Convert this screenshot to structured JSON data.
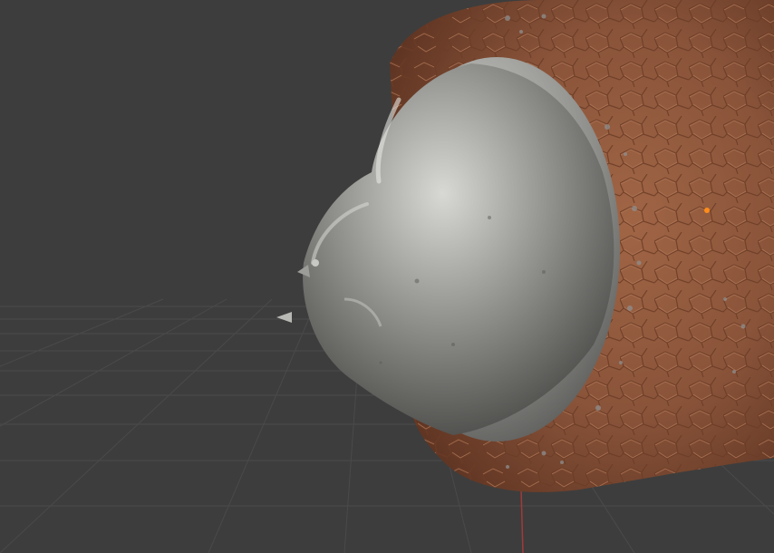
{
  "viewport": {
    "background_color": "#3d3d3d",
    "grid_color": "#4a4a4a",
    "x_axis_color": "#a13a3a"
  },
  "model": {
    "body_color": "#8a543a",
    "metal_color": "#9a9a98",
    "origin_marker_color": "#ff8c1a"
  }
}
